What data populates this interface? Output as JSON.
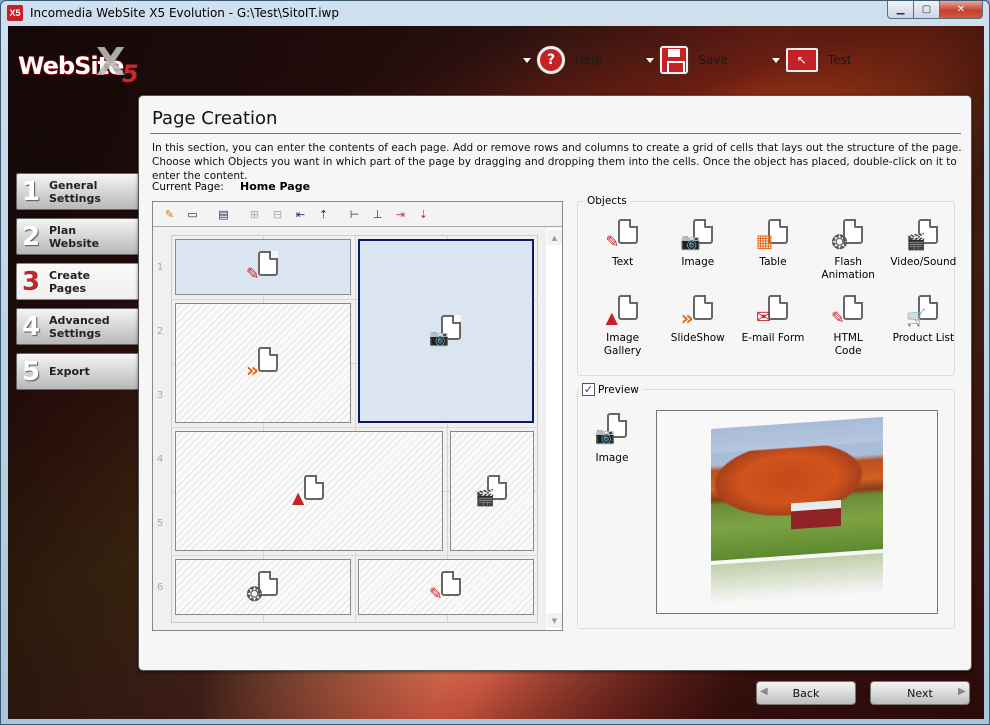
{
  "window": {
    "title": "Incomedia WebSite X5 Evolution - G:\\Test\\SitoIT.iwp",
    "app_icon": "X5",
    "controls": {
      "minimize": "minimize-icon",
      "maximize": "maximize-icon",
      "close": "close-icon"
    }
  },
  "logo": {
    "text": "WebSite",
    "x": "X",
    "five": "5"
  },
  "topbar": [
    {
      "label": "Help",
      "icon": "help-icon"
    },
    {
      "label": "Save",
      "icon": "floppy-disk-icon"
    },
    {
      "label": "Test",
      "icon": "monitor-pointer-icon"
    }
  ],
  "steps": [
    {
      "num": "1",
      "label": "General\nSettings",
      "active": false
    },
    {
      "num": "2",
      "label": "Plan\nWebsite",
      "active": false
    },
    {
      "num": "3",
      "label": "Create\nPages",
      "active": true
    },
    {
      "num": "4",
      "label": "Advanced\nSettings",
      "active": false
    },
    {
      "num": "5",
      "label": "Export",
      "active": false
    }
  ],
  "panel": {
    "title": "Page Creation",
    "description": "In this section, you can enter the contents of each page. Add or remove rows and columns to create a grid of cells that lays out the structure of the page. Choose which Objects you want in which part of the page by dragging and dropping them into the cells. Once the object has placed, double-click on it to enter the content.",
    "current_page_label": "Current Page:",
    "current_page_value": "Home Page"
  },
  "editor": {
    "toolbar": [
      {
        "name": "edit-cell-icon",
        "glyph": "✎",
        "disabled": false
      },
      {
        "name": "window-icon",
        "glyph": "▭",
        "disabled": false
      },
      {
        "name": "merge-rows-icon",
        "glyph": "▤",
        "disabled": false
      },
      {
        "name": "add-column-icon",
        "glyph": "⊞",
        "disabled": true
      },
      {
        "name": "add-row-icon",
        "glyph": "⊟",
        "disabled": true
      },
      {
        "name": "insert-column-left-icon",
        "glyph": "⇤",
        "disabled": false
      },
      {
        "name": "insert-row-above-icon",
        "glyph": "⇡",
        "disabled": false
      },
      {
        "name": "split-horizontal-icon",
        "glyph": "⊢",
        "disabled": false
      },
      {
        "name": "split-vertical-icon",
        "glyph": "⊥",
        "disabled": false
      },
      {
        "name": "delete-column-icon",
        "glyph": "⇥",
        "disabled": false
      },
      {
        "name": "delete-row-icon",
        "glyph": "⇣",
        "disabled": false
      }
    ],
    "row_numbers": [
      "1",
      "2",
      "3",
      "4",
      "5",
      "6"
    ],
    "cells": [
      {
        "object": "Text",
        "state": "filled"
      },
      {
        "object": "Image",
        "state": "selected"
      },
      {
        "object": "SlideShow",
        "state": "empty"
      },
      {
        "object": "Image Gallery",
        "state": "empty"
      },
      {
        "object": "Video/Sound",
        "state": "empty"
      },
      {
        "object": "Flash Animation",
        "state": "empty"
      },
      {
        "object": "HTML Code",
        "state": "empty"
      }
    ]
  },
  "objects": {
    "label": "Objects",
    "items": [
      {
        "label": "Text",
        "icon": "text-object-icon",
        "glyph": "✎",
        "color": "#c62127"
      },
      {
        "label": "Image",
        "icon": "image-object-icon",
        "glyph": "📷",
        "color": "#666666"
      },
      {
        "label": "Table",
        "icon": "table-object-icon",
        "glyph": "▦",
        "color": "#e8661a"
      },
      {
        "label": "Flash\nAnimation",
        "icon": "flash-animation-icon",
        "glyph": "❂",
        "color": "#555555"
      },
      {
        "label": "Video/Sound",
        "icon": "video-sound-icon",
        "glyph": "🎬",
        "color": "#c62127"
      },
      {
        "label": "Image\nGallery",
        "icon": "image-gallery-icon",
        "glyph": "▲",
        "color": "#c62127"
      },
      {
        "label": "SlideShow",
        "icon": "slideshow-icon",
        "glyph": "»",
        "color": "#e8661a"
      },
      {
        "label": "E-mail Form",
        "icon": "email-form-icon",
        "glyph": "✉",
        "color": "#c62127"
      },
      {
        "label": "HTML\nCode",
        "icon": "html-code-icon",
        "glyph": "✎",
        "color": "#c62127"
      },
      {
        "label": "Product List",
        "icon": "product-list-icon",
        "glyph": "🛒",
        "color": "#c62127"
      }
    ]
  },
  "preview": {
    "label": "Preview",
    "checked": true,
    "object_label": "Image"
  },
  "nav": {
    "back": "Back",
    "next": "Next"
  }
}
